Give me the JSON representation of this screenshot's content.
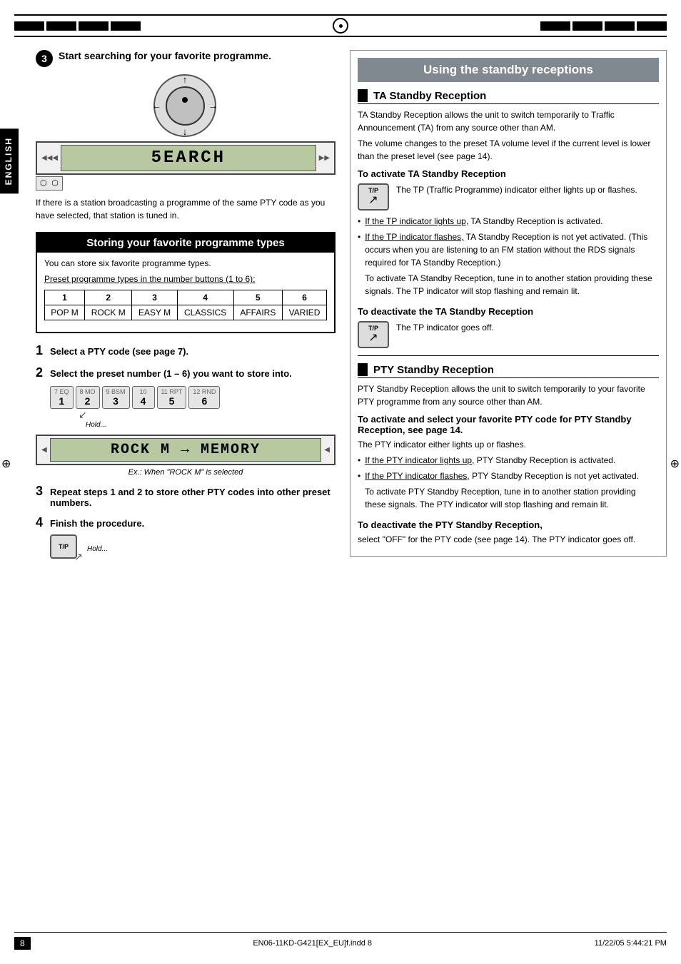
{
  "page": {
    "number": "8",
    "footer_left": "EN06-11KD-G421[EX_EU]f.indd  8",
    "footer_right": "11/22/05  5:44:21 PM"
  },
  "english_label": "ENGLISH",
  "step3": {
    "number": "3",
    "title": "Start searching for your favorite programme.",
    "note": "If there is a station broadcasting a programme of the same PTY code as you have selected, that station is tuned in."
  },
  "storing_section": {
    "title": "Storing your favorite programme types",
    "intro": "You can store six favorite programme types.",
    "preset_label": "Preset programme types in the number buttons (1 to 6):",
    "preset_numbers": [
      "1",
      "2",
      "3",
      "4",
      "5",
      "6"
    ],
    "preset_names": [
      "POP M",
      "ROCK M",
      "EASY M",
      "CLASSICS",
      "AFFAIRS",
      "VARIED"
    ]
  },
  "steps": {
    "step1": {
      "number": "1",
      "text": "Select a PTY code (see page 7)."
    },
    "step2": {
      "number": "2",
      "text": "Select the preset number (1 – 6) you want to store into."
    },
    "step2_hold": "Hold...",
    "step2_ex": "Ex.: When \"ROCK M\" is selected",
    "step3_repeat": {
      "number": "3",
      "text": "Repeat steps 1 and 2 to store other PTY codes into other preset numbers."
    },
    "step4": {
      "number": "4",
      "text": "Finish the procedure."
    },
    "step4_hold": "Hold..."
  },
  "right_col": {
    "main_title": "Using the standby receptions",
    "ta_section": {
      "title": "TA Standby Reception",
      "body1": "TA Standby Reception allows the unit to switch temporarily to Traffic Announcement (TA) from any source other than AM.",
      "body2": "The volume changes to the preset TA volume level if the current level is lower than the preset level (see page 14).",
      "activate_label": "To activate TA Standby Reception",
      "activate_body": "The TP (Traffic Programme) indicator either lights up or flashes.",
      "bullet1_underline": "If the TP indicator lights up,",
      "bullet1_text": " TA Standby Reception is activated.",
      "bullet2_underline": "If the TP indicator flashes,",
      "bullet2_text": " TA Standby Reception is not yet activated. (This occurs when you are listening to an FM station without the RDS signals required for TA Standby Reception.)",
      "bullet2_extra": "To activate TA Standby Reception, tune in to another station providing these signals. The TP indicator will stop flashing and remain lit.",
      "deactivate_label": "To deactivate the TA Standby Reception",
      "deactivate_body": "The TP indicator goes off."
    },
    "pty_section": {
      "title": "PTY Standby Reception",
      "body1": "PTY Standby Reception allows the unit to switch temporarily to your favorite PTY programme from any source other than AM.",
      "activate_label": "To activate and select your favorite PTY code for PTY Standby Reception,",
      "activate_body": "see page 14.",
      "activate_body2": "The PTY indicator either lights up or flashes.",
      "bullet1_underline": "If the PTY indicator lights up,",
      "bullet1_text": " PTY Standby Reception is activated.",
      "bullet2_underline": "If the PTY indicator flashes,",
      "bullet2_text": " PTY Standby Reception is not yet activated.",
      "bullet2_extra": "To activate PTY Standby Reception, tune in to another station providing these signals. The PTY indicator will stop flashing and remain lit.",
      "deactivate_label": "To deactivate the PTY Standby Reception,",
      "deactivate_body": "select \"OFF\" for the PTY code (see page 14). The PTY indicator goes off."
    }
  },
  "lcd_search": "5EARCH",
  "lcd_rock_memory": "ROCK M → MEMORY"
}
